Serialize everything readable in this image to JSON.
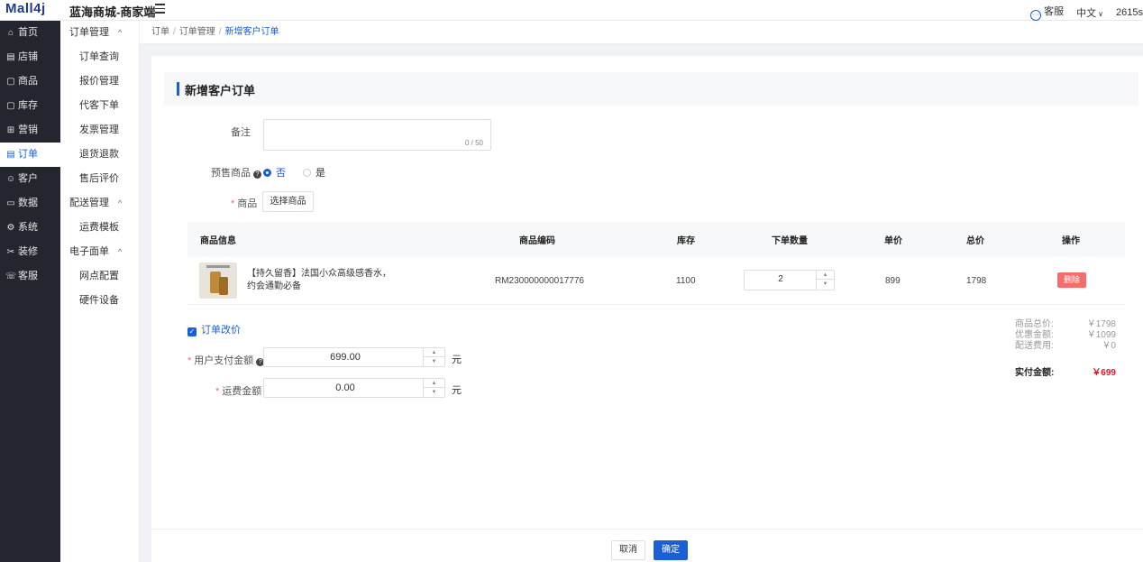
{
  "header": {
    "logo_text": "Mall4j",
    "brand_name": "蓝海商城-商家端",
    "service_label": "客服",
    "language": "中文",
    "user_partial": "2615s"
  },
  "sidebar": {
    "items": [
      {
        "label": "首页",
        "icon": "home-icon",
        "glyph": "⌂"
      },
      {
        "label": "店铺",
        "icon": "shop-icon",
        "glyph": "▤"
      },
      {
        "label": "商品",
        "icon": "goods-icon",
        "glyph": "▢"
      },
      {
        "label": "库存",
        "icon": "stock-icon",
        "glyph": "▢"
      },
      {
        "label": "营销",
        "icon": "marketing-icon",
        "glyph": "⊞"
      },
      {
        "label": "订单",
        "icon": "order-icon",
        "glyph": "▤"
      },
      {
        "label": "客户",
        "icon": "customer-icon",
        "glyph": "☺"
      },
      {
        "label": "数据",
        "icon": "data-icon",
        "glyph": "▭"
      },
      {
        "label": "系统",
        "icon": "system-icon",
        "glyph": "⚙"
      },
      {
        "label": "装修",
        "icon": "decorate-icon",
        "glyph": "✂"
      },
      {
        "label": "客服",
        "icon": "service-icon",
        "glyph": "☏"
      }
    ],
    "active_index": 5
  },
  "submenu": {
    "order_group": "订单管理",
    "order_items": [
      "订单查询",
      "报价管理",
      "代客下单",
      "发票管理",
      "退货退款",
      "售后评价"
    ],
    "delivery_group": "配送管理",
    "delivery_items": [
      "运费模板"
    ],
    "waybill_group": "电子面单",
    "waybill_items": [
      "网点配置",
      "硬件设备"
    ]
  },
  "breadcrumb": [
    "订单",
    "订单管理",
    "新增客户订单"
  ],
  "page": {
    "title": "新增客户订单",
    "remark_label": "备注",
    "remark_count": "0 / 50",
    "presale_label": "预售商品",
    "presale_no": "否",
    "presale_yes": "是",
    "goods_label": "商品",
    "choose_goods": "选择商品"
  },
  "table": {
    "headers": [
      "商品信息",
      "商品编码",
      "库存",
      "下单数量",
      "单价",
      "总价",
      "操作"
    ],
    "rows": [
      {
        "name_line1": "【持久留香】法国小众高级感香水，",
        "name_line2": "约会通勤必备",
        "code": "RM230000000017776",
        "stock": "1100",
        "qty": "2",
        "unit_price": "899",
        "total": "1798",
        "action": "删除"
      }
    ]
  },
  "price_change": {
    "checkbox_label": "订单改价",
    "pay_label": "用户支付金额",
    "pay_value": "699.00",
    "shipping_label": "运费金额",
    "shipping_value": "0.00",
    "unit": "元"
  },
  "summary": {
    "goods_total_label": "商品总价:",
    "goods_total": "￥1798",
    "discount_label": "优惠金额:",
    "discount": "￥1099",
    "shipping_label": "配送费用:",
    "shipping": "￥0",
    "paid_label": "实付金额:",
    "paid": "￥699"
  },
  "footer": {
    "cancel": "取消",
    "confirm": "确定"
  },
  "colors": {
    "primary": "#1a5fd8",
    "danger": "#f56c6c",
    "sidebar_bg": "#23262e",
    "price_red": "#e0182b"
  }
}
